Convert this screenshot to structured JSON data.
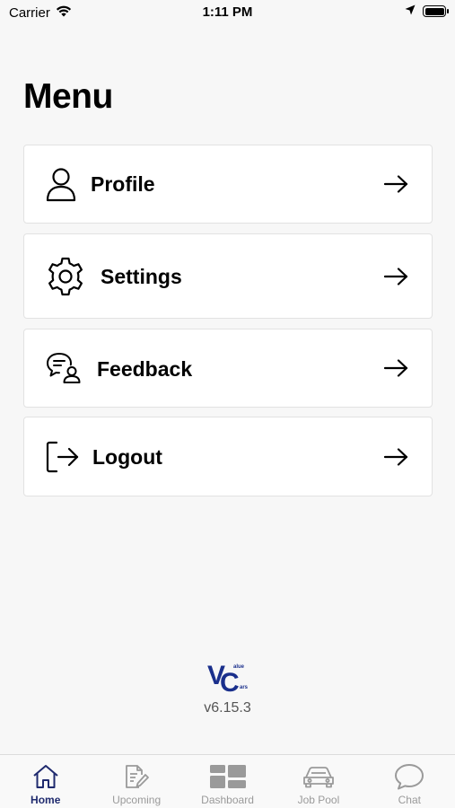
{
  "status_bar": {
    "carrier": "Carrier",
    "time": "1:11 PM"
  },
  "page": {
    "title": "Menu"
  },
  "menu": {
    "items": [
      {
        "label": "Profile",
        "icon": "user-icon"
      },
      {
        "label": "Settings",
        "icon": "gear-icon"
      },
      {
        "label": "Feedback",
        "icon": "feedback-icon"
      },
      {
        "label": "Logout",
        "icon": "logout-icon"
      }
    ]
  },
  "footer": {
    "logo_letters": "VC",
    "logo_text": "alue ars",
    "version": "v6.15.3"
  },
  "tabs": [
    {
      "label": "Home",
      "icon": "home-icon",
      "active": true
    },
    {
      "label": "Upcoming",
      "icon": "document-edit-icon",
      "active": false
    },
    {
      "label": "Dashboard",
      "icon": "dashboard-icon",
      "active": false
    },
    {
      "label": "Job Pool",
      "icon": "car-icon",
      "active": false
    },
    {
      "label": "Chat",
      "icon": "chat-bubble-icon",
      "active": false
    }
  ],
  "colors": {
    "background": "#f7f7f7",
    "card": "#ffffff",
    "active_tab": "#1f2a6e",
    "inactive_tab": "#9a9a9a",
    "logo_blue": "#1a2f8c"
  }
}
